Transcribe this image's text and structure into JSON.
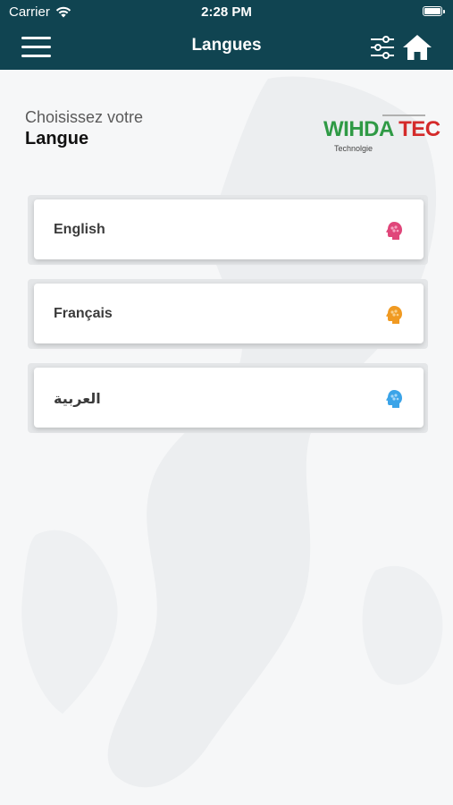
{
  "status_bar": {
    "carrier": "Carrier",
    "time": "2:28 PM"
  },
  "nav": {
    "title": "Langues",
    "menu_icon": "hamburger-menu-icon",
    "filter_icon": "sliders-icon",
    "home_icon": "home-icon"
  },
  "heading": {
    "line1": "Choisissez votre",
    "line2": "Langue"
  },
  "logo": {
    "text_green": "WIHDA",
    "text_red": "TEC",
    "subtitle": "Technolgie"
  },
  "languages": [
    {
      "label": "English",
      "icon": "brain-head-icon",
      "icon_color": "#e0467a"
    },
    {
      "label": "Français",
      "icon": "brain-head-icon",
      "icon_color": "#f09a22"
    },
    {
      "label": "العربية",
      "icon": "brain-head-icon",
      "icon_color": "#3ba4e8"
    }
  ],
  "colors": {
    "nav_background": "#104451",
    "page_background": "#f6f7f8",
    "logo_green": "#2f9a45",
    "logo_red": "#d42a2a"
  }
}
